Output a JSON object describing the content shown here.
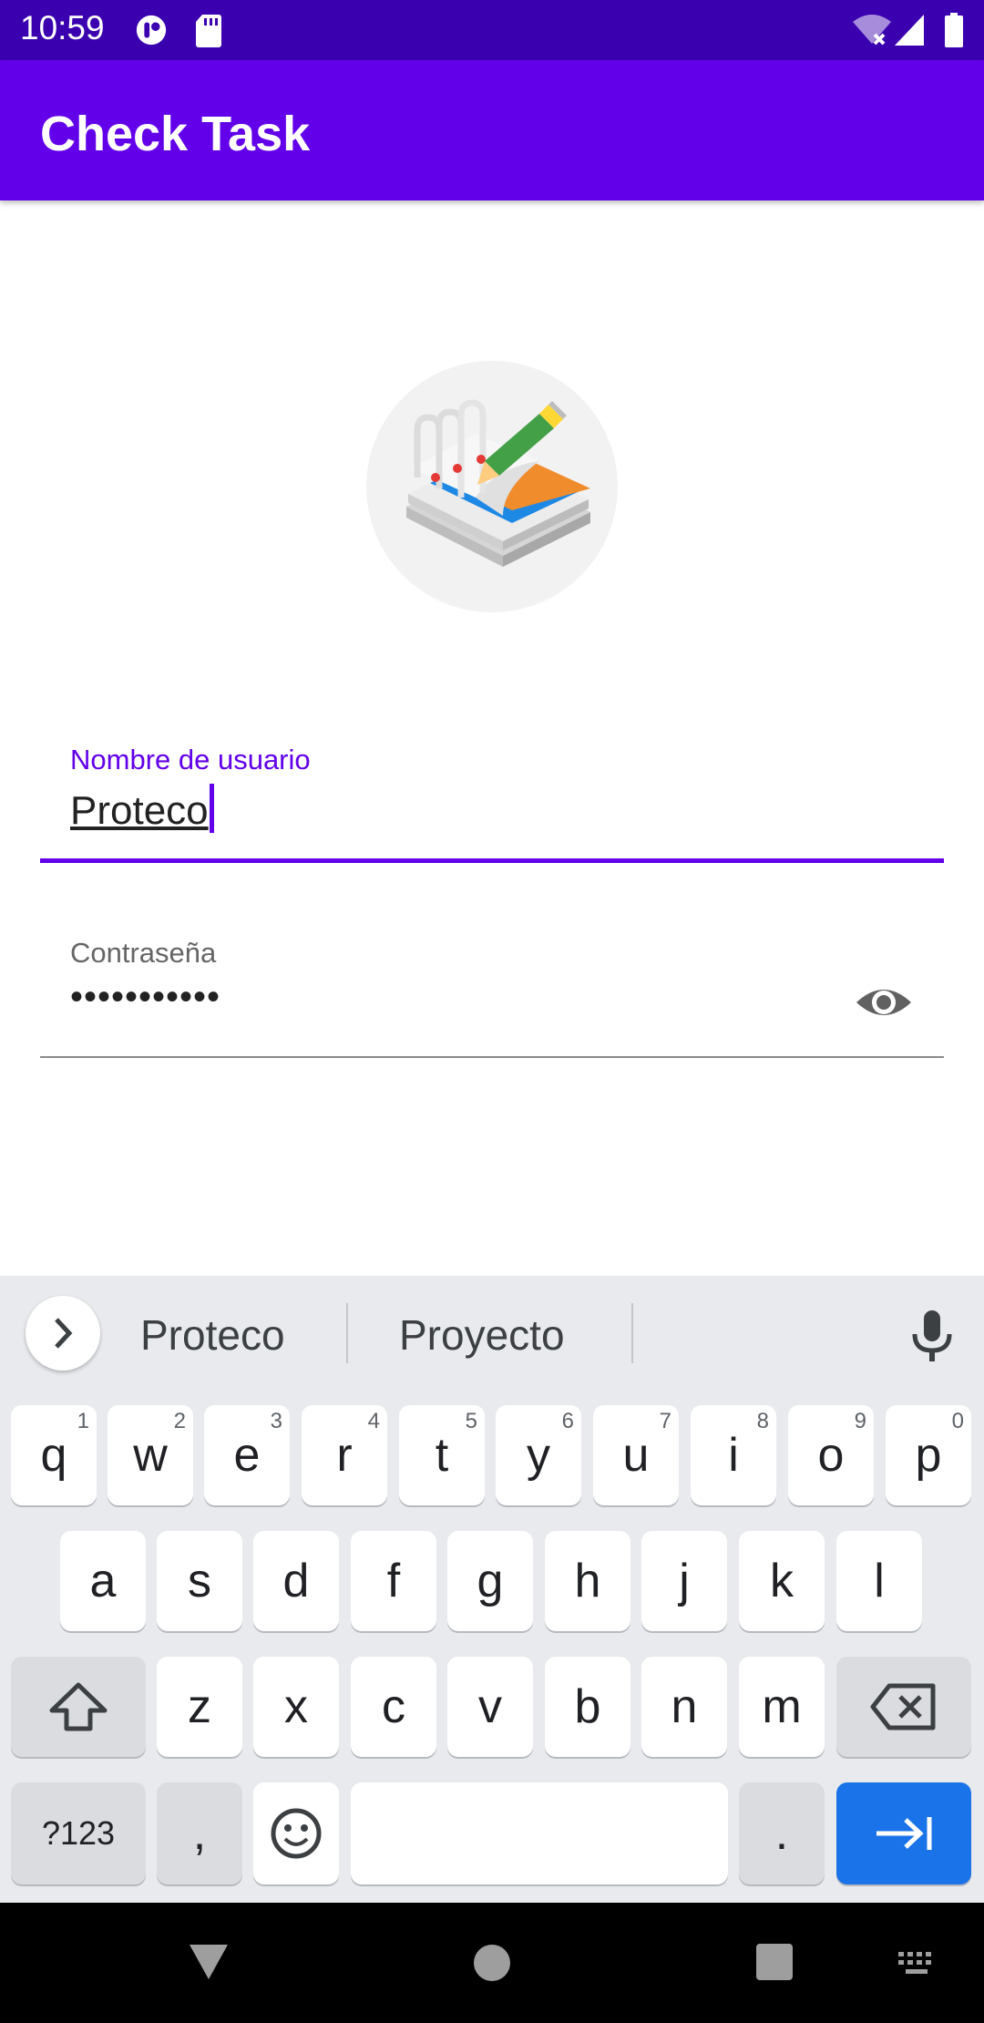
{
  "status_bar": {
    "time": "10:59",
    "icons": [
      "notification-icon",
      "sd-card-icon",
      "wifi-icon",
      "signal-icon",
      "battery-icon"
    ]
  },
  "app_bar": {
    "title": "Check Task"
  },
  "logo": {
    "icon": "notepad-pencil-icon"
  },
  "form": {
    "username": {
      "label": "Nombre de usuario",
      "value": "Proteco"
    },
    "password": {
      "label": "Contraseña",
      "value": "•••••••••••",
      "toggle_icon": "eye-icon"
    }
  },
  "keyboard": {
    "suggestions": [
      "Proteco",
      "Proyecto"
    ],
    "row1": [
      {
        "k": "q",
        "h": "1"
      },
      {
        "k": "w",
        "h": "2"
      },
      {
        "k": "e",
        "h": "3"
      },
      {
        "k": "r",
        "h": "4"
      },
      {
        "k": "t",
        "h": "5"
      },
      {
        "k": "y",
        "h": "6"
      },
      {
        "k": "u",
        "h": "7"
      },
      {
        "k": "i",
        "h": "8"
      },
      {
        "k": "o",
        "h": "9"
      },
      {
        "k": "p",
        "h": "0"
      }
    ],
    "row2": [
      "a",
      "s",
      "d",
      "f",
      "g",
      "h",
      "j",
      "k",
      "l"
    ],
    "row3": [
      "z",
      "x",
      "c",
      "v",
      "b",
      "n",
      "m"
    ],
    "symbols_label": "?123",
    "comma_label": ",",
    "period_label": "."
  },
  "colors": {
    "status_bar": "#3a00b0",
    "app_bar": "#6200ea",
    "accent": "#6200ea",
    "keyboard_bg": "#e8eaed",
    "enter_key": "#1a73e8"
  }
}
